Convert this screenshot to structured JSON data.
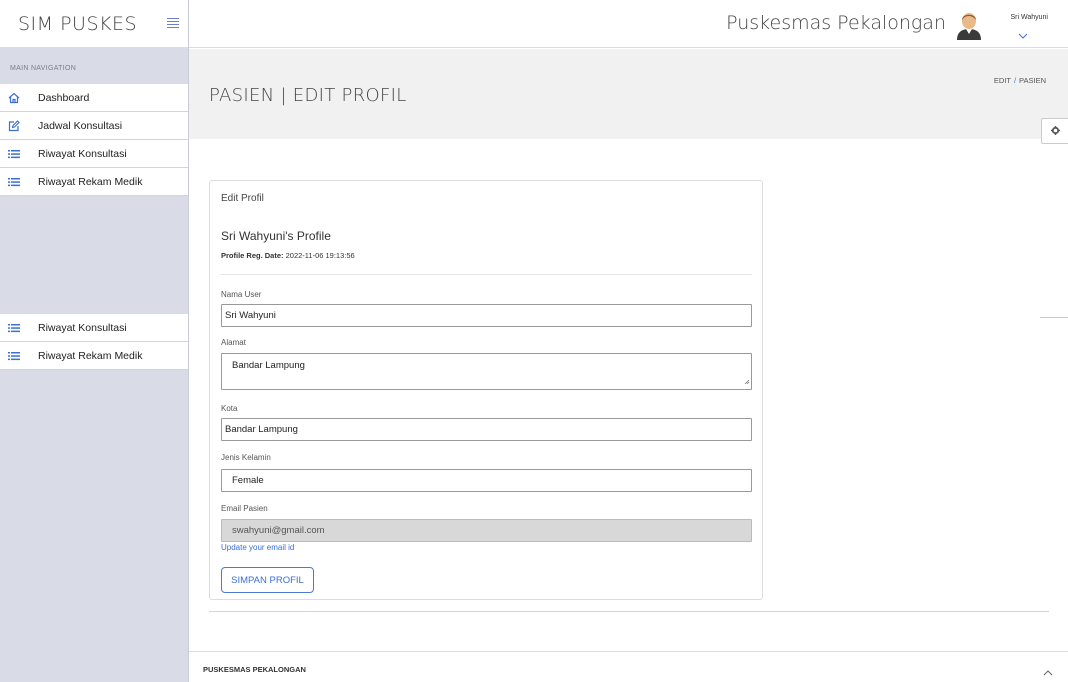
{
  "brand": {
    "title": "SIM PUSKES"
  },
  "sidebar": {
    "header": "MAIN NAVIGATION",
    "items": [
      {
        "label": "Dashboard",
        "icon": "home-icon"
      },
      {
        "label": "Jadwal Konsultasi",
        "icon": "edit-icon"
      },
      {
        "label": "Riwayat Konsultasi",
        "icon": "list-icon"
      },
      {
        "label": "Riwayat Rekam Medik",
        "icon": "list-icon"
      }
    ],
    "items2": [
      {
        "label": "Riwayat Konsultasi",
        "icon": "list-icon"
      },
      {
        "label": "Riwayat Rekam Medik",
        "icon": "list-icon"
      }
    ]
  },
  "topbar": {
    "org": "Puskesmas Pekalongan",
    "user": "Sri Wahyuni"
  },
  "page": {
    "title": "PASIEN | EDIT PROFIL",
    "breadcrumb": [
      "EDIT",
      "PASIEN"
    ]
  },
  "card": {
    "title": "Edit Profil",
    "profile_heading": "Sri Wahyuni's Profile",
    "reg_label": "Profile Reg. Date:",
    "reg_value": "2022-11-06 19:13:56",
    "fields": {
      "nama": {
        "label": "Nama User",
        "value": "Sri Wahyuni"
      },
      "alamat": {
        "label": "Alamat",
        "value": "Bandar Lampung"
      },
      "kota": {
        "label": "Kota",
        "value": "Bandar Lampung"
      },
      "gender": {
        "label": "Jenis Kelamin",
        "value": "Female"
      },
      "email": {
        "label": "Email Pasien",
        "value": "swahyuni@gmail.com"
      }
    },
    "update_link": "Update your email id",
    "save_label": "SIMPAN PROFIL"
  },
  "footer": {
    "text": "PUSKESMAS PEKALONGAN"
  },
  "colors": {
    "accent": "#3b6fd6",
    "sidebar_bg": "#d9dbe6",
    "header_bg": "#f1f1f1"
  }
}
